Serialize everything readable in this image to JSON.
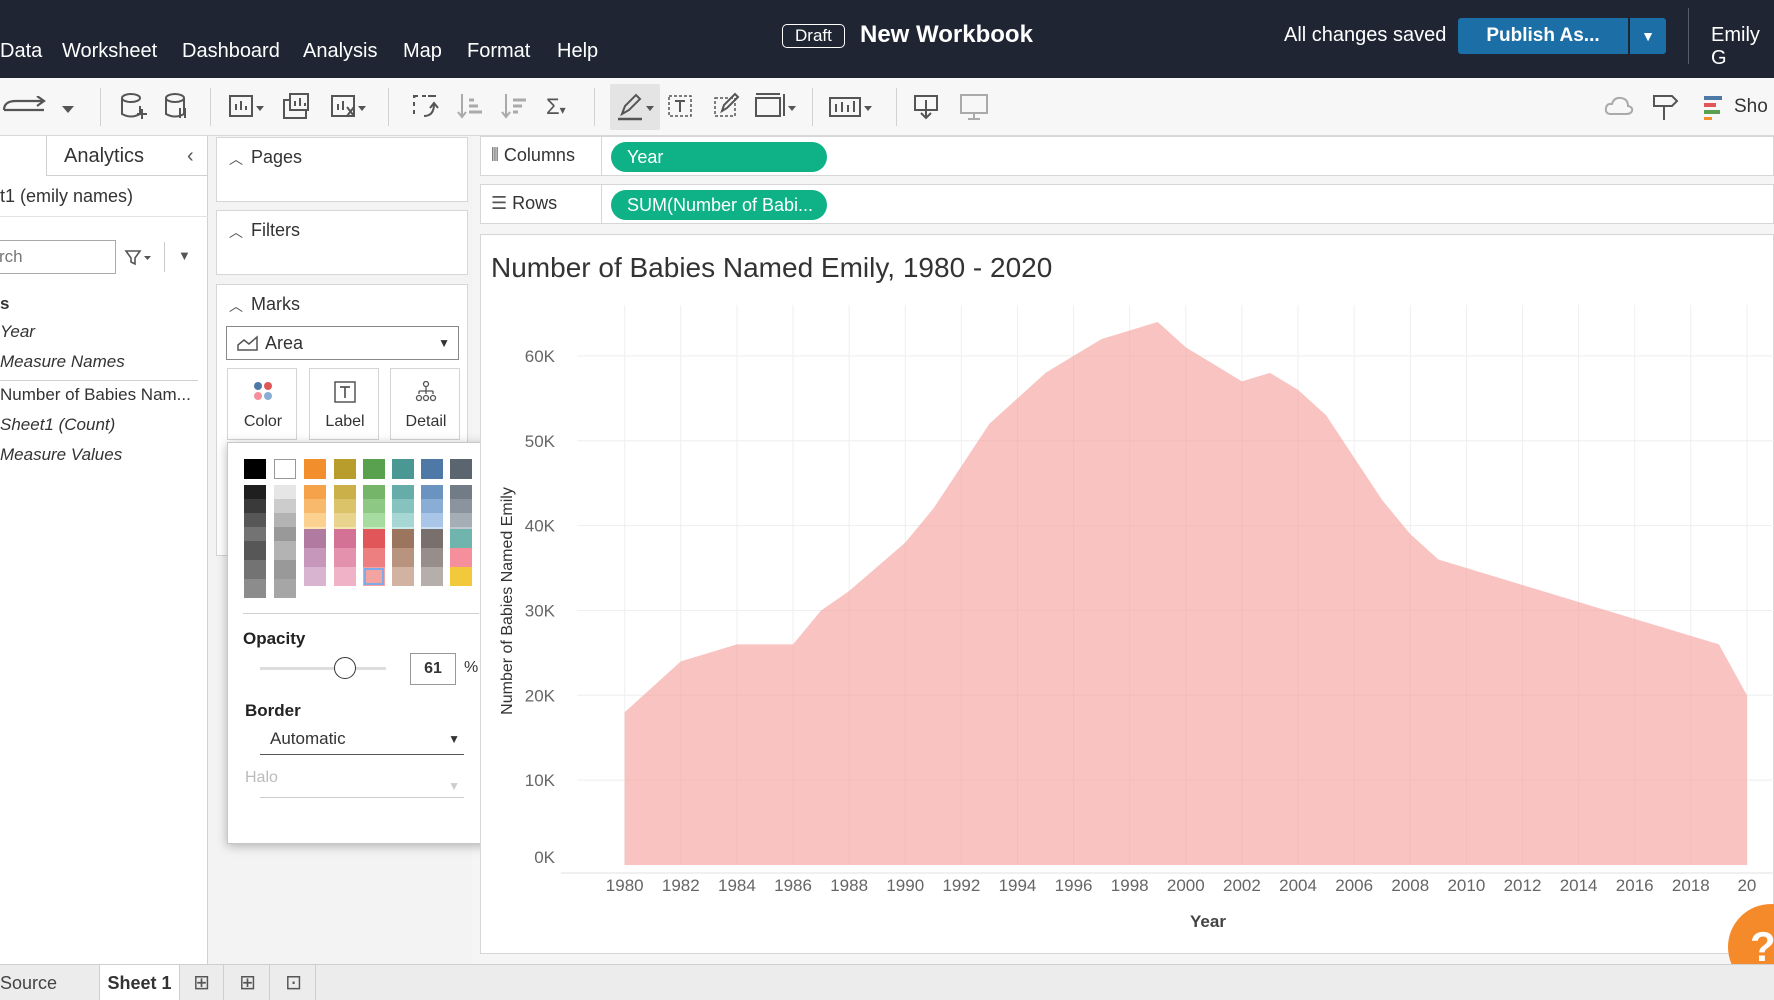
{
  "topbar": {
    "menus": [
      "Data",
      "Worksheet",
      "Dashboard",
      "Analysis",
      "Map",
      "Format",
      "Help"
    ],
    "draft_badge": "Draft",
    "workbook_title": "New Workbook",
    "save_status": "All changes saved",
    "publish_label": "Publish As...",
    "user_name": "Emily G"
  },
  "toolbar": {
    "show_me_label": "Sho"
  },
  "data_pane": {
    "analytics_tab": "Analytics",
    "datasource": "t1 (emily names)",
    "search_placeholder": "rch",
    "section_label": "s",
    "fields": [
      "Year",
      "Measure Names",
      "Number of Babies Nam...",
      "Sheet1 (Count)",
      "Measure Values"
    ]
  },
  "cards": {
    "pages": "Pages",
    "filters": "Filters",
    "marks": "Marks",
    "mark_type": "Area",
    "color": "Color",
    "label": "Label",
    "detail": "Detail"
  },
  "color_popup": {
    "opacity_label": "Opacity",
    "opacity_value": "61",
    "opacity_fraction": 0.61,
    "percent": "%",
    "border_label": "Border",
    "border_value": "Automatic",
    "halo_label": "Halo",
    "selected_color": "#f4a4a0",
    "palette": [
      [
        "#000000",
        "#1f1f1f",
        "#3a3a3a",
        "#575757",
        "#737373"
      ],
      [
        "#ffffff",
        "#e6e6e6",
        "#cccccc",
        "#b3b3b3",
        "#999999"
      ],
      [
        "#f28e2b",
        "#f5a24a",
        "#f9b96c",
        "#fcd08f",
        "#ffe5b3"
      ],
      [
        "#b89d2c",
        "#cbb04a",
        "#dbc36a",
        "#e8d48c",
        "#f3e6b0"
      ],
      [
        "#59a14f",
        "#74b56a",
        "#8dc985",
        "#a7dca0",
        "#c3ecbd"
      ],
      [
        "#499894",
        "#66ada9",
        "#86c3bf",
        "#a6d7d4",
        "#c7ebe9"
      ],
      [
        "#4e79a7",
        "#6b93c0",
        "#8aadd6",
        "#a9c6e8",
        "#cadef5"
      ],
      [
        "#5b6570",
        "#727c87",
        "#8b949e",
        "#a5adb5",
        "#c1c7cd"
      ]
    ],
    "palette_row2": [
      [
        "#b07aa1",
        "#c697ba",
        "#d8b4d0"
      ],
      [
        "#d37295",
        "#e391ad",
        "#f0b2c6"
      ],
      [
        "#e15759",
        "#ee7f80",
        "#f4a4a0"
      ],
      [
        "#9c755f",
        "#b8937e",
        "#d2b3a1"
      ],
      [
        "#79706e",
        "#978e8b",
        "#b6aeab"
      ],
      [
        "#6fb5ae",
        "#f58f9b",
        "#f1c93b"
      ]
    ]
  },
  "shelves": {
    "columns_label": "Columns",
    "rows_label": "Rows",
    "columns_pill": "Year",
    "rows_pill": "SUM(Number of Babi..."
  },
  "chart_data": {
    "type": "area",
    "title": "Number of Babies Named Emily, 1980 - 2020",
    "xlabel": "Year",
    "ylabel": "Number of Babies Named Emily",
    "x": [
      1980,
      1982,
      1984,
      1986,
      1987,
      1988,
      1990,
      1991,
      1992,
      1993,
      1994,
      1995,
      1996,
      1997,
      1998,
      1999,
      2000,
      2001,
      2002,
      2003,
      2004,
      2005,
      2006,
      2007,
      2008,
      2009,
      2010,
      2011,
      2012,
      2013,
      2014,
      2015,
      2016,
      2017,
      2018,
      2019,
      2020
    ],
    "y": [
      18000,
      24000,
      26000,
      26000,
      30000,
      32300,
      38000,
      42000,
      47000,
      52000,
      55000,
      58000,
      60000,
      62000,
      63000,
      64000,
      61000,
      59000,
      57000,
      58000,
      56000,
      53000,
      48000,
      43000,
      39000,
      36000,
      35000,
      34000,
      33000,
      32000,
      31000,
      30000,
      29000,
      28000,
      27000,
      26000,
      20000
    ],
    "x_ticks": [
      "1980",
      "1982",
      "1984",
      "1986",
      "1988",
      "1990",
      "1992",
      "1994",
      "1996",
      "1998",
      "2000",
      "2002",
      "2004",
      "2006",
      "2008",
      "2010",
      "2012",
      "2014",
      "2016",
      "2018",
      "20"
    ],
    "y_ticks": [
      "0K",
      "10K",
      "20K",
      "30K",
      "40K",
      "50K",
      "60K"
    ],
    "ylim": [
      0,
      66000
    ],
    "fill_color": "#f4a4a0",
    "grid": true
  },
  "bottom": {
    "datasource_tab": "Source",
    "sheet_tab": "Sheet 1"
  },
  "help_label": "?"
}
